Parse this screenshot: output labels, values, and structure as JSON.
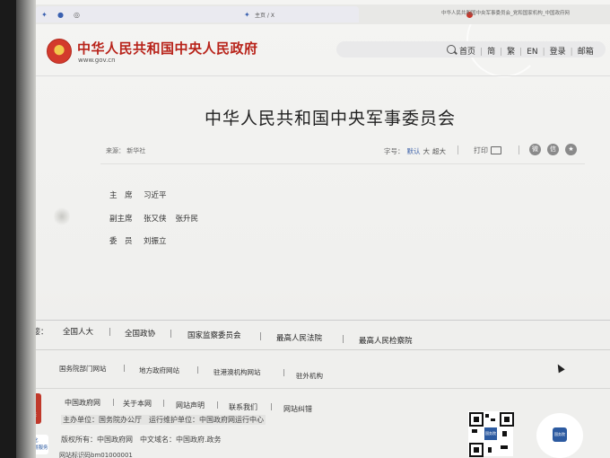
{
  "browser": {
    "tab_left_title": "主页 / X",
    "tab_right_title": "中华人民共和国中央军事委员会_党和国家机构_中国政府网",
    "fav_icons": [
      "twitter-icon",
      "facebook-icon",
      "share-icon"
    ]
  },
  "header": {
    "site_title": "中华人民共和国中央人民政府",
    "site_url": "www.gov.cn",
    "nav": [
      "首页",
      "简",
      "繁",
      "EN",
      "登录",
      "邮箱"
    ]
  },
  "article": {
    "title": "中华人民共和国中央军事委员会",
    "source": "来源： 新华社",
    "font_label": "字号：",
    "font_options": [
      "默认",
      "大",
      "超大"
    ],
    "print_label": "打印",
    "share_icons": [
      "weibo-icon",
      "wechat-icon",
      "qzone-icon"
    ],
    "members": [
      {
        "role": "主　席",
        "names": [
          "习近平"
        ]
      },
      {
        "role": "副主席",
        "names": [
          "张又侠",
          "张升民"
        ]
      },
      {
        "role": "委　员",
        "names": [
          "刘振立"
        ]
      }
    ]
  },
  "footer": {
    "links_label": "链接：",
    "links": [
      "全国人大",
      "全国政协",
      "国家监察委员会",
      "最高人民法院",
      "最高人民检察院"
    ],
    "sublinks": [
      "国务院部门网站",
      "地方政府网站",
      "驻港澳机构网站",
      "驻外机构"
    ],
    "bottom_links": [
      "中国政府网",
      "关于本网",
      "网站声明",
      "联系我们",
      "网站纠错"
    ],
    "sponsor": "主办单位：国务院办公厅　运行维护单位：中国政府网运行中心",
    "copyright": "版权所有：中国政府网　中文域名：中国政府.政务",
    "filing": "网站标识码bm01000001",
    "badge_text": "党政机关",
    "access_text": [
      "适老化",
      "无障碍服务"
    ],
    "qr_center_1": "国务院",
    "qr_center_2": "国务院"
  }
}
